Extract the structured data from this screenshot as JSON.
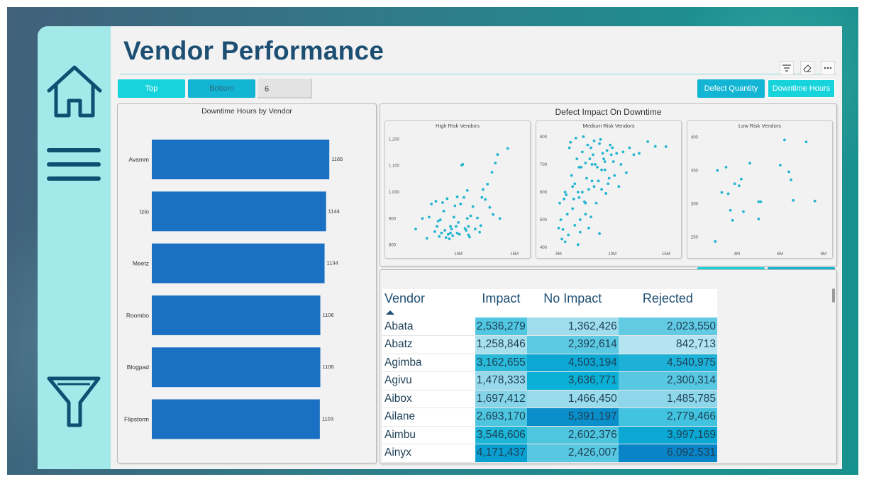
{
  "title": "Vendor Performance",
  "colors": {
    "accent_cyan": "#16d3dc",
    "accent_blue": "#12b5d3",
    "bar": "#1a70c2",
    "title": "#1d4f73",
    "dot": "#22b5d0"
  },
  "sidebar": {
    "icons": [
      "home-icon",
      "hamburger-menu-icon",
      "filter-icon"
    ]
  },
  "toolbar": {
    "icons": [
      "filter-icon",
      "eraser-icon",
      "more-options-icon"
    ]
  },
  "controls": {
    "top_label": "Top",
    "bottom_label": "Bottom",
    "n_value": "6",
    "defect_quantity_label": "Defect Quantity",
    "downtime_hours_label": "Downtime Hours"
  },
  "chart_data": [
    {
      "type": "bar",
      "title": "Downtime Hours by Vendor",
      "orientation": "horizontal",
      "categories": [
        "Avamm",
        "Izio",
        "Meetz",
        "Roombo",
        "Blogpad",
        "Flipstorm"
      ],
      "values": [
        1165,
        1144,
        1134,
        1106,
        1106,
        1103
      ],
      "value_labels": [
        "1165",
        "1144",
        "1134",
        "1106",
        "1106",
        "1103"
      ]
    },
    {
      "type": "scatter",
      "title": "Defect Impact On Downtime",
      "panels": [
        {
          "name": "High Risk Vendors",
          "xlim": [
            5000000,
            16000000
          ],
          "ylim": [
            780,
            1220
          ],
          "x_ticks": [
            "10M",
            "15M"
          ],
          "x_tick_values": [
            10000000,
            15000000
          ],
          "y_ticks": [
            "1,200",
            "1,100",
            "1,000",
            "900",
            "800"
          ],
          "y_tick_values": [
            1200,
            1100,
            1000,
            900,
            800
          ],
          "points": [
            [
              6200000.0,
              860
            ],
            [
              6800000.0,
              900
            ],
            [
              7400000.0,
              905
            ],
            [
              7600000.0,
              955
            ],
            [
              7900000.0,
              850
            ],
            [
              8100000.0,
              870
            ],
            [
              8200000.0,
              890
            ],
            [
              8300000.0,
              832
            ],
            [
              8500000.0,
              845
            ],
            [
              8600000.0,
              960
            ],
            [
              8700000.0,
              928
            ],
            [
              8800000.0,
              855
            ],
            [
              8900000.0,
              828
            ],
            [
              9000000.0,
              975
            ],
            [
              9100000.0,
              840
            ],
            [
              9200000.0,
              823
            ],
            [
              9300000.0,
              845
            ],
            [
              9400000.0,
              860
            ],
            [
              9500000.0,
              835
            ],
            [
              9600000.0,
              905
            ],
            [
              9700000.0,
              948
            ],
            [
              9800000.0,
              870
            ],
            [
              9900000.0,
              845
            ],
            [
              10000000.0,
              885
            ],
            [
              10100000.0,
              840
            ],
            [
              10200000.0,
              955
            ],
            [
              10300000.0,
              1102
            ],
            [
              10400000.0,
              1105
            ],
            [
              10500000.0,
              980
            ],
            [
              10600000.0,
              862
            ],
            [
              10700000.0,
              855
            ],
            [
              10800000.0,
              900
            ],
            [
              10900000.0,
              838
            ],
            [
              11000000.0,
              830
            ],
            [
              11100000.0,
              910
            ],
            [
              11300000.0,
              945
            ],
            [
              11500000.0,
              860
            ],
            [
              11700000.0,
              902
            ],
            [
              11900000.0,
              848
            ],
            [
              12100000.0,
              980
            ],
            [
              12200000.0,
              1010
            ],
            [
              12400000.0,
              972
            ],
            [
              12600000.0,
              1030
            ],
            [
              12800000.0,
              942
            ],
            [
              13000000.0,
              1075
            ],
            [
              13100000.0,
              915
            ],
            [
              13300000.0,
              1110
            ],
            [
              13500000.0,
              1142
            ],
            [
              13700000.0,
              900
            ],
            [
              14400000.0,
              1165
            ],
            [
              8000000.0,
              965
            ],
            [
              9900000.0,
              982
            ],
            [
              10800000.0,
              1006
            ],
            [
              7200000.0,
              825
            ],
            [
              12000000.0,
              873
            ],
            [
              10900000.0,
              870
            ],
            [
              9300000.0,
              870
            ],
            [
              8400000.0,
              895
            ]
          ]
        },
        {
          "name": "Medium Risk Vendors",
          "xlim": [
            4500000,
            16000000
          ],
          "ylim": [
            390,
            810
          ],
          "x_ticks": [
            "5M",
            "10M",
            "15M"
          ],
          "x_tick_values": [
            5000000,
            10000000,
            15000000
          ],
          "y_ticks": [
            "800",
            "700",
            "600",
            "500",
            "400"
          ],
          "y_tick_values": [
            800,
            700,
            600,
            500,
            400
          ],
          "points": [
            [
              5000000.0,
              470
            ],
            [
              5100000.0,
              560
            ],
            [
              5200000.0,
              500
            ],
            [
              5300000.0,
              430
            ],
            [
              5400000.0,
              465
            ],
            [
              5500000.0,
              575
            ],
            [
              5600000.0,
              600
            ],
            [
              5700000.0,
              590
            ],
            [
              5800000.0,
              520
            ],
            [
              5900000.0,
              445
            ],
            [
              6000000.0,
              760
            ],
            [
              6100000.0,
              780
            ],
            [
              6200000.0,
              660
            ],
            [
              6300000.0,
              540
            ],
            [
              6400000.0,
              575
            ],
            [
              6500000.0,
              630
            ],
            [
              6600000.0,
              795
            ],
            [
              6700000.0,
              720
            ],
            [
              6800000.0,
              600
            ],
            [
              6900000.0,
              580
            ],
            [
              7000000.0,
              500
            ],
            [
              7100000.0,
              690
            ],
            [
              7200000.0,
              745
            ],
            [
              7300000.0,
              800
            ],
            [
              7400000.0,
              565
            ],
            [
              7500000.0,
              705
            ],
            [
              7600000.0,
              650
            ],
            [
              7700000.0,
              770
            ],
            [
              7800000.0,
              610
            ],
            [
              7900000.0,
              720
            ],
            [
              8000000.0,
              760
            ],
            [
              8100000.0,
              640
            ],
            [
              8200000.0,
              735
            ],
            [
              8300000.0,
              785
            ],
            [
              8400000.0,
              700
            ],
            [
              8500000.0,
              560
            ],
            [
              8600000.0,
              690
            ],
            [
              8700000.0,
              640
            ],
            [
              8800000.0,
              775
            ],
            [
              8900000.0,
              790
            ],
            [
              9000000.0,
              680
            ],
            [
              9100000.0,
              740
            ],
            [
              9200000.0,
              720
            ],
            [
              9300000.0,
              710
            ],
            [
              9400000.0,
              595
            ],
            [
              9500000.0,
              750
            ],
            [
              9600000.0,
              630
            ],
            [
              9700000.0,
              650
            ],
            [
              9800000.0,
              770
            ],
            [
              9900000.0,
              735
            ],
            [
              10000000.0,
              760
            ],
            [
              10200000.0,
              660
            ],
            [
              10400000.0,
              740
            ],
            [
              10600000.0,
              620
            ],
            [
              10800000.0,
              700
            ],
            [
              11000000.0,
              745
            ],
            [
              11300000.0,
              670
            ],
            [
              11600000.0,
              760
            ],
            [
              12000000.0,
              735
            ],
            [
              12500000.0,
              740
            ],
            [
              13300000.0,
              782
            ],
            [
              14000000.0,
              765
            ],
            [
              15000000.0,
              764
            ],
            [
              6500000.0,
              480
            ],
            [
              7000000.0,
              455
            ],
            [
              7500000.0,
              520
            ],
            [
              8000000.0,
              510
            ],
            [
              6800000.0,
              410
            ],
            [
              5600000.0,
              420
            ],
            [
              7800000.0,
              470
            ],
            [
              8800000.0,
              450
            ],
            [
              6300000.0,
              620
            ],
            [
              7200000.0,
              600
            ],
            [
              8300000.0,
              620
            ],
            [
              9000000.0,
              610
            ],
            [
              7500000.0,
              560
            ],
            [
              6900000.0,
              690
            ],
            [
              8100000.0,
              700
            ],
            [
              9300000.0,
              680
            ],
            [
              10100000.0,
              710
            ]
          ]
        },
        {
          "name": "Low Risk Vendors",
          "xlim": [
            2500000,
            8200000
          ],
          "ylim": [
            230,
            405
          ],
          "x_ticks": [
            "4M",
            "6M",
            "8M"
          ],
          "x_tick_values": [
            4000000,
            6000000,
            8000000
          ],
          "y_ticks": [
            "400",
            "350",
            "300",
            "250"
          ],
          "y_tick_values": [
            400,
            350,
            300,
            250
          ],
          "points": [
            [
              3000000.0,
              243
            ],
            [
              3100000.0,
              350
            ],
            [
              3300000.0,
              317
            ],
            [
              3500000.0,
              355
            ],
            [
              3600000.0,
              315
            ],
            [
              3700000.0,
              290
            ],
            [
              3800000.0,
              275
            ],
            [
              3900000.0,
              330
            ],
            [
              4100000.0,
              327
            ],
            [
              4200000.0,
              337
            ],
            [
              4300000.0,
              288
            ],
            [
              4600000.0,
              361
            ],
            [
              5000000.0,
              303
            ],
            [
              5100000.0,
              303
            ],
            [
              5000000.0,
              277
            ],
            [
              6000000.0,
              358
            ],
            [
              6200000.0,
              396
            ],
            [
              6400000.0,
              348
            ],
            [
              6500000.0,
              336
            ],
            [
              6600000.0,
              305
            ],
            [
              7200000.0,
              393
            ],
            [
              7600000.0,
              304
            ]
          ]
        }
      ]
    }
  ],
  "table": {
    "columns": [
      "Vendor",
      "Impact",
      "No Impact",
      "Rejected"
    ],
    "rows": [
      {
        "vendor": "Abata",
        "impact": "2,536,279",
        "no_impact": "1,362,426",
        "rejected": "2,023,550",
        "shades": [
          "#52c7e1",
          "#9fdcec",
          "#62cbe3"
        ]
      },
      {
        "vendor": "Abatz",
        "impact": "1,258,846",
        "no_impact": "2,392,614",
        "rejected": "842,713",
        "shades": [
          "#a8e0ee",
          "#5cc9e2",
          "#b4e4f0"
        ]
      },
      {
        "vendor": "Agimba",
        "impact": "3,162,655",
        "no_impact": "4,503,194",
        "rejected": "4,540,975",
        "shades": [
          "#2bbad9",
          "#0ca8d3",
          "#1eb1d7"
        ]
      },
      {
        "vendor": "Agivu",
        "impact": "1,478,333",
        "no_impact": "3,636,771",
        "rejected": "2,300,314",
        "shades": [
          "#97d9ea",
          "#0bb0d6",
          "#58c8e2"
        ]
      },
      {
        "vendor": "Aibox",
        "impact": "1,697,412",
        "no_impact": "1,466,450",
        "rejected": "1,485,785",
        "shades": [
          "#86d4e8",
          "#99daeb",
          "#8ed6e9"
        ]
      },
      {
        "vendor": "Ailane",
        "impact": "2,693,170",
        "no_impact": "5,391,197",
        "rejected": "2,779,466",
        "shades": [
          "#4ec6e0",
          "#0a8fcb",
          "#42c3df"
        ]
      },
      {
        "vendor": "Aimbu",
        "impact": "3,546,606",
        "no_impact": "2,602,376",
        "rejected": "3,997,169",
        "shades": [
          "#1db5d8",
          "#4ec6e0",
          "#0aa8d3"
        ]
      },
      {
        "vendor": "Ainyx",
        "impact": "4,171,437",
        "no_impact": "2,426,007",
        "rejected": "6,092,531",
        "shades": [
          "#0a9fd0",
          "#58c8e2",
          "#0a84c8"
        ]
      }
    ]
  }
}
